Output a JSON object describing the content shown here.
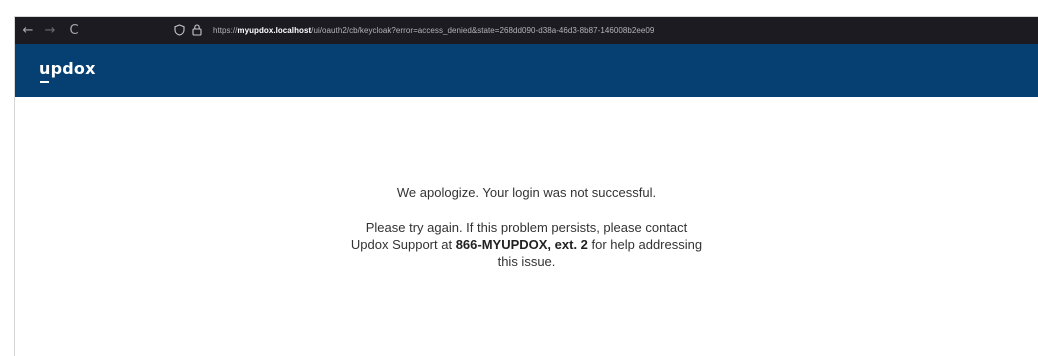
{
  "browser": {
    "back_icon": "←",
    "forward_icon": "→",
    "reload_icon": "C",
    "url_prefix": "https://",
    "url_host": "myupdox.localhost",
    "url_path": "/ui/oauth2/cb/keycloak?error=access_denied&state=268dd090-d38a-46d3-8b87-146008b2ee09"
  },
  "header": {
    "logo_text": "updox",
    "background_color": "#063f71"
  },
  "message": {
    "apology": "We apologize. Your login was not successful.",
    "retry_text_before": "Please try again. If this problem persists, please contact Updox Support at ",
    "phone": "866-MYUPDOX, ext. 2",
    "retry_text_after": " for help addressing this issue."
  }
}
